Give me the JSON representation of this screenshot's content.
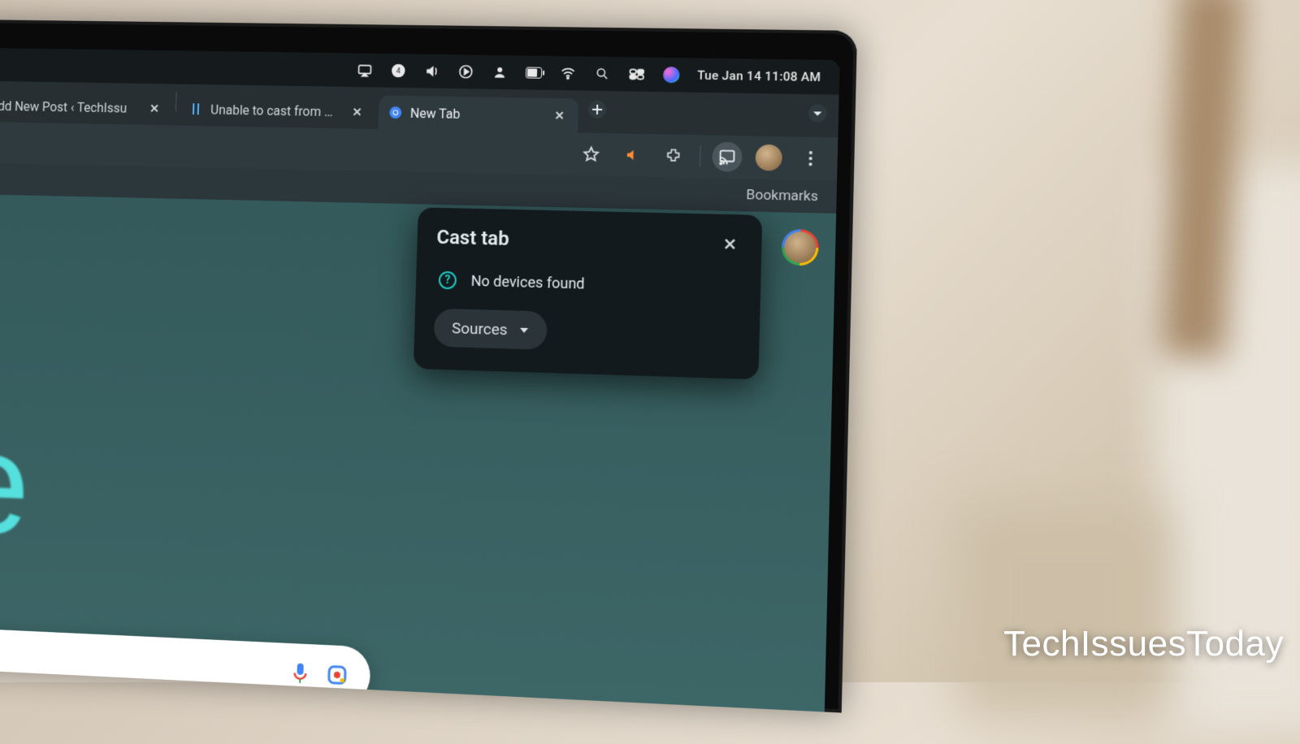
{
  "menubar": {
    "clock": "Tue Jan 14  11:08 AM"
  },
  "tabs": [
    {
      "title": "Add New Post ‹ TechIssu"
    },
    {
      "title": "Unable to cast from Chro"
    },
    {
      "title": "New Tab"
    }
  ],
  "bookmarks_label": "Bookmarks",
  "cast_popup": {
    "title": "Cast tab",
    "message": "No devices found",
    "sources_label": "Sources"
  },
  "google_fragment": "le",
  "watermark": "TechIssuesToday"
}
